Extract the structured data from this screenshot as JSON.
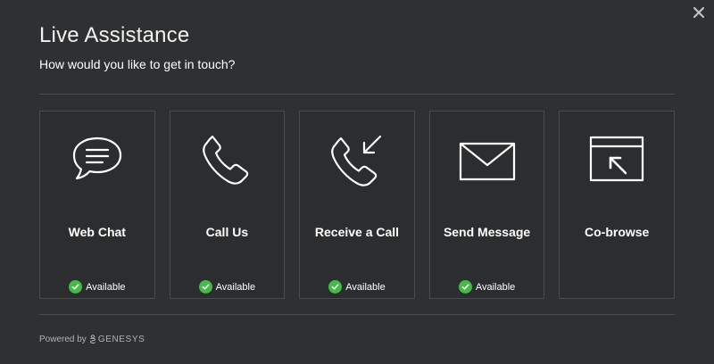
{
  "dialog": {
    "title": "Live Assistance",
    "subtitle": "How would you like to get in touch?",
    "close_icon": "close-icon"
  },
  "options": [
    {
      "label": "Web Chat",
      "icon": "chat-bubble-icon",
      "status": "Available"
    },
    {
      "label": "Call Us",
      "icon": "phone-icon",
      "status": "Available"
    },
    {
      "label": "Receive a Call",
      "icon": "incoming-call-icon",
      "status": "Available"
    },
    {
      "label": "Send Message",
      "icon": "envelope-icon",
      "status": "Available"
    },
    {
      "label": "Co-browse",
      "icon": "co-browse-icon",
      "status": ""
    }
  ],
  "footer": {
    "powered_by": "Powered by",
    "brand": "GENESYS",
    "brand_icon": "genesys-logo-icon"
  },
  "colors": {
    "background": "#2e3032",
    "card_border": "#494c4e",
    "available": "#46b947"
  }
}
